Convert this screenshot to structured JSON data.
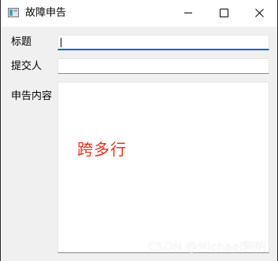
{
  "window": {
    "title": "故障申告"
  },
  "form": {
    "title_label": "标题",
    "title_value": "",
    "submitter_label": "提交人",
    "submitter_value": "",
    "content_label": "申告内容",
    "content_value": "跨多行"
  },
  "watermark": "CSDN @Michael阿明",
  "icons": {
    "app": "app-window-icon",
    "minimize": "minimize-icon",
    "maximize": "maximize-icon",
    "close": "close-icon"
  },
  "colors": {
    "focus_accent": "#0067c0",
    "content_text": "#e1321d"
  }
}
